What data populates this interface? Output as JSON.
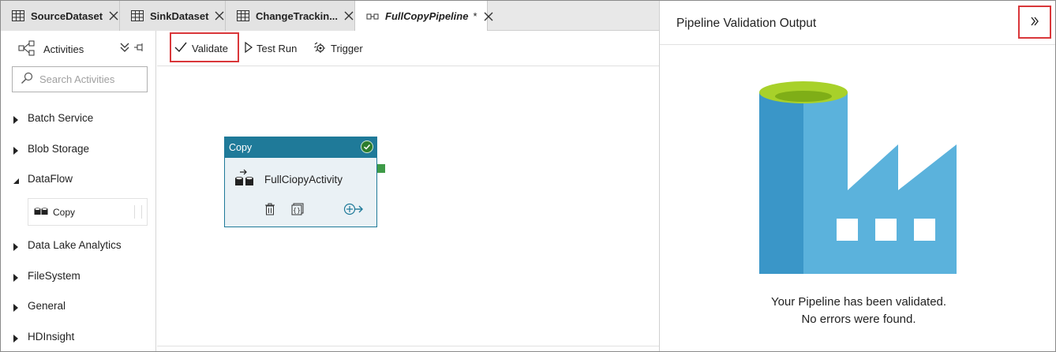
{
  "tabs": [
    {
      "label": "SourceDataset",
      "icon": "table-icon"
    },
    {
      "label": "SinkDataset",
      "icon": "table-icon"
    },
    {
      "label": "ChangeTrackin...",
      "icon": "table-icon"
    },
    {
      "label": "FullCopyPipeline",
      "modified_marker": "*",
      "icon": "pipeline-icon",
      "active": true
    }
  ],
  "sidebar": {
    "title": "Activities",
    "search_placeholder": "Search Activities",
    "categories": [
      {
        "label": "Batch Service",
        "expanded": false
      },
      {
        "label": "Blob Storage",
        "expanded": false
      },
      {
        "label": "DataFlow",
        "expanded": true
      },
      {
        "label": "Data Lake Analytics",
        "expanded": false
      },
      {
        "label": "FileSystem",
        "expanded": false
      },
      {
        "label": "General",
        "expanded": false
      },
      {
        "label": "HDInsight",
        "expanded": false
      }
    ],
    "dataflow_items": [
      {
        "label": "Copy",
        "icon": "copy-activity-icon"
      }
    ]
  },
  "toolbar": {
    "validate_label": "Validate",
    "test_run_label": "Test Run",
    "trigger_label": "Trigger"
  },
  "canvas": {
    "activity": {
      "type_label": "Copy",
      "name": "FullCiopyActivity",
      "status": "validated"
    }
  },
  "validation_panel": {
    "title": "Pipeline Validation Output",
    "message_line1": "Your Pipeline has been validated.",
    "message_line2": "No errors were found."
  },
  "colors": {
    "accent_red": "#d9373a",
    "node_header": "#1f7a99",
    "factory_dark": "#3a96c8",
    "factory_light": "#5bb2dc",
    "lime": "#a8d12a",
    "success_green": "#2d7d2d"
  }
}
